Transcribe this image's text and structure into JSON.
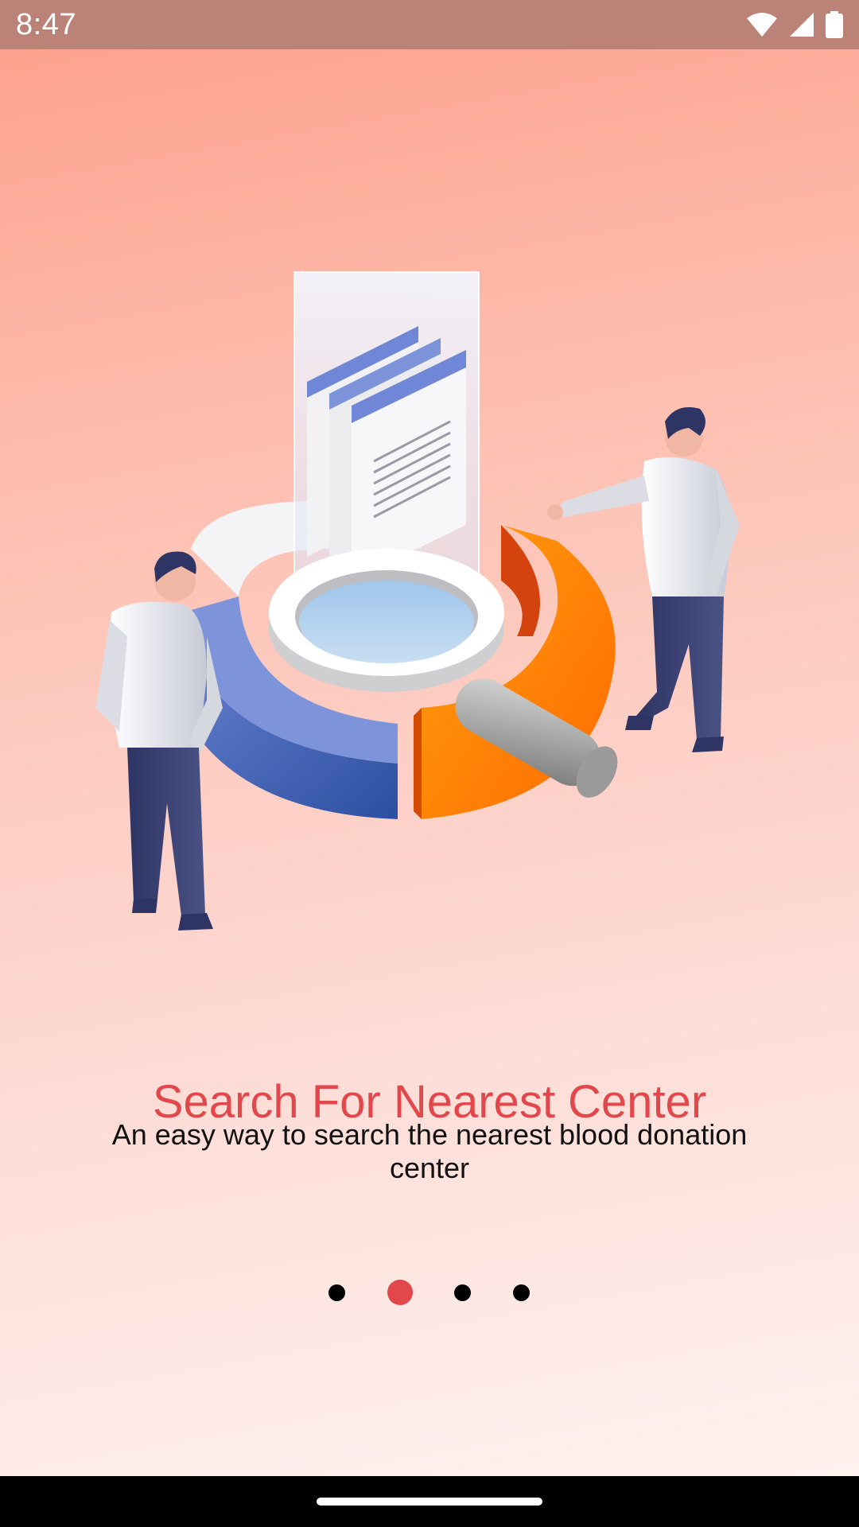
{
  "status_bar": {
    "time": "8:47",
    "icons": [
      "wifi-icon",
      "cellular-signal-icon",
      "battery-icon"
    ]
  },
  "illustration": {
    "subject": "search-analytics-illustration"
  },
  "onboarding": {
    "title": "Search For Nearest Center",
    "subtitle": "An easy way to search the nearest blood donation center",
    "page_count": 4,
    "active_page": 2
  },
  "colors": {
    "accent": "#e2484b",
    "status_bar": "#bb8278",
    "background_top": "#fd9f8c",
    "background_bottom": "#fff4f2",
    "dot_inactive": "#000000"
  }
}
